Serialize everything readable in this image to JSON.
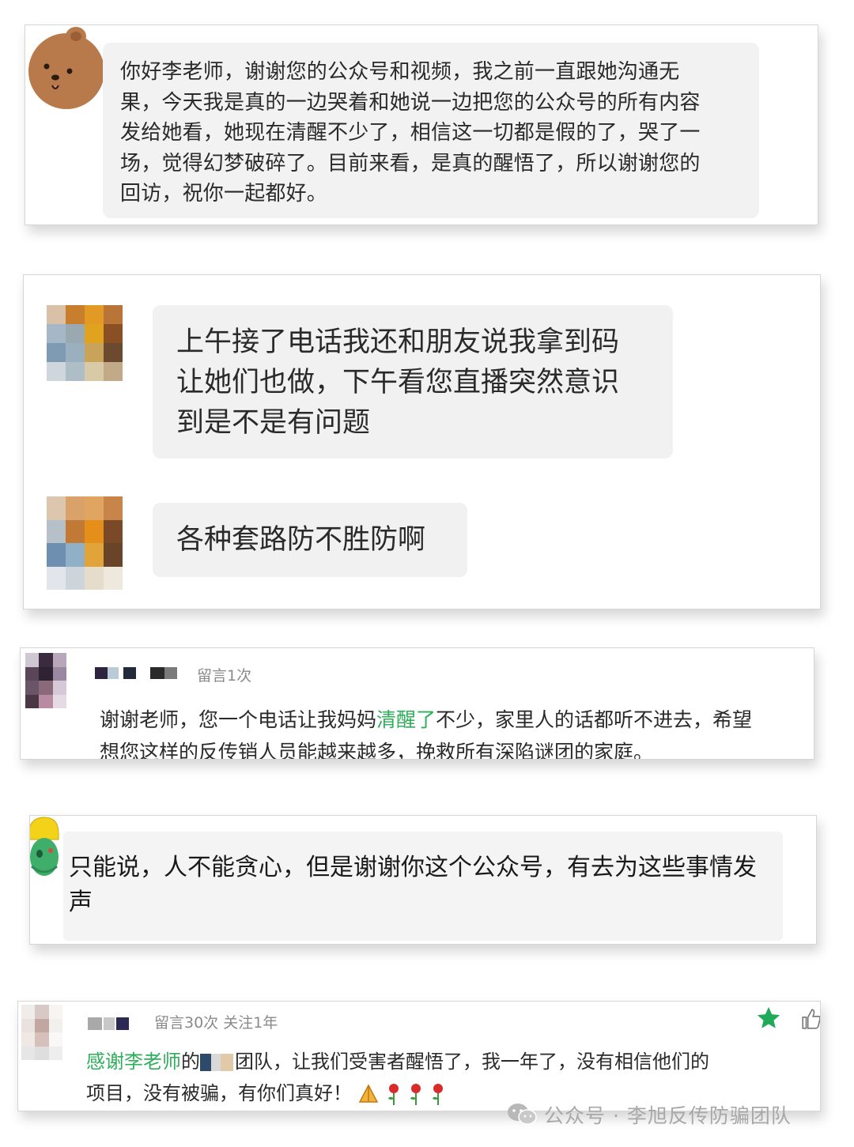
{
  "card1": {
    "message": "你好李老师，谢谢您的公众号和视频，我之前一直跟她沟通无\n果，今天我是真的一边哭着和她说一边把您的公众号的所有内容\n发给她看，她现在清醒不少了，相信这一切都是假的了，哭了一\n场，觉得幻梦破碎了。目前来看，是真的醒悟了，所以谢谢您的\n回访，祝你一起都好。"
  },
  "card2": {
    "message1": "上午接了电话我还和朋友说我拿到码\n让她们也做，下午看您直播突然意识\n到是不是有问题",
    "message2": "各种套路防不胜防啊"
  },
  "card3": {
    "meta": "留言1次",
    "text_before": "谢谢老师，您一个电话让我妈妈",
    "text_highlight": "清醒了",
    "text_after": "不少，家里人的话都听不进去，希望\n想您这样的反传销人员能越来越多，挽救所有深陷谜团的家庭。"
  },
  "card4": {
    "message": "只能说，人不能贪心，但是谢谢你这个公众号，有去为这些事情发\n声"
  },
  "card5": {
    "meta": "留言30次 关注1年",
    "text_highlight": "感谢李老师",
    "text_mid": "的",
    "text_after": "团队，让我们受害者醒悟了，我一年了，没有相信他们的\n项目，没有被骗，有你们真好！"
  },
  "watermark": {
    "text": "公众号 · 李旭反传防骗团队"
  },
  "colors": {
    "highlight_green": "#2fae5b",
    "star_green": "#1faa5a",
    "bubble_gray": "#f1f1f1"
  },
  "icons": [
    "bear-avatar-icon",
    "parrot-avatar-icon",
    "star-icon",
    "thumbs-up-icon",
    "hands-icon",
    "rose-icon",
    "wechat-icon"
  ]
}
